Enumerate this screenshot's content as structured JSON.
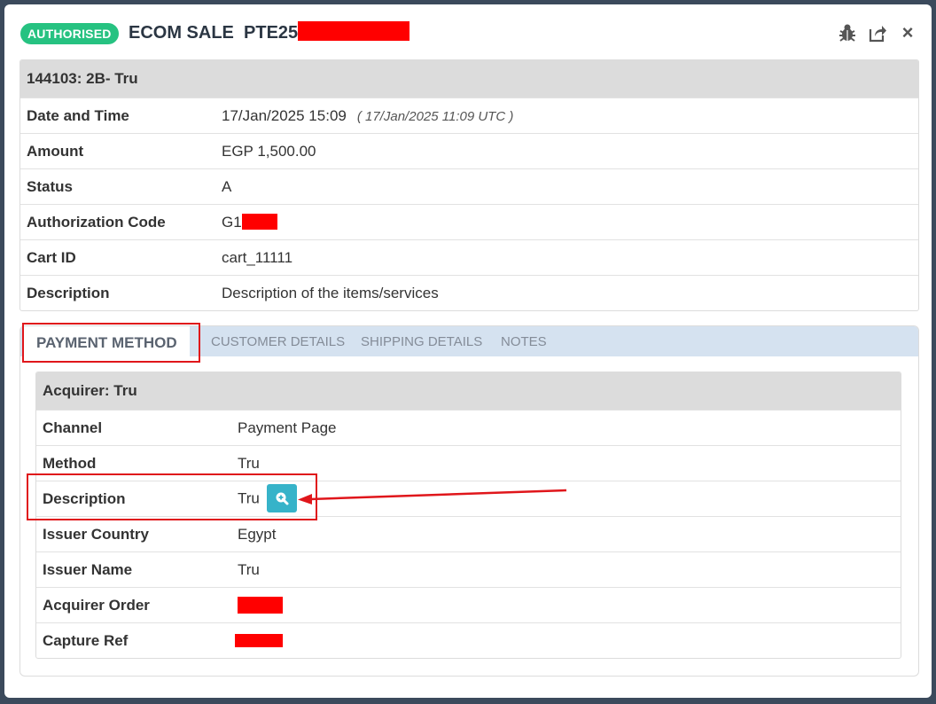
{
  "header": {
    "status_badge": "AUTHORISED",
    "title_prefix": "ECOM SALE  PTE25",
    "icons": [
      "bug-icon",
      "share-icon",
      "close-icon"
    ],
    "close_glyph": "×"
  },
  "summary": {
    "heading": "144103: 2B- Tru",
    "rows": [
      {
        "label": "Date and Time",
        "value": "17/Jan/2025 15:09",
        "extra": "( 17/Jan/2025 11:09 UTC )"
      },
      {
        "label": "Amount",
        "value": "EGP 1,500.00"
      },
      {
        "label": "Status",
        "value": "A"
      },
      {
        "label": "Authorization Code",
        "value": "G1"
      },
      {
        "label": "Cart ID",
        "value": "cart_11111"
      },
      {
        "label": "Description",
        "value": "Description of the items/services"
      }
    ]
  },
  "tabs": [
    {
      "label": "PAYMENT METHOD",
      "active": true
    },
    {
      "label": "CUSTOMER DETAILS",
      "active": false
    },
    {
      "label": "SHIPPING DETAILS",
      "active": false
    },
    {
      "label": "NOTES",
      "active": false
    }
  ],
  "payment": {
    "heading": "Acquirer: Tru",
    "rows": [
      {
        "label": "Channel",
        "value": "Payment Page"
      },
      {
        "label": "Method",
        "value": "Tru"
      },
      {
        "label": "Description",
        "value": "Tru"
      },
      {
        "label": "Issuer Country",
        "value": "Egypt"
      },
      {
        "label": "Issuer Name",
        "value": "Tru"
      },
      {
        "label": "Acquirer Order",
        "value": ""
      },
      {
        "label": "Capture Ref",
        "value": ""
      }
    ]
  },
  "colors": {
    "badge": "#26c281",
    "tabbar": "#d5e2f0",
    "zoom_button": "#36b3c9",
    "annotation": "#e0161b"
  }
}
